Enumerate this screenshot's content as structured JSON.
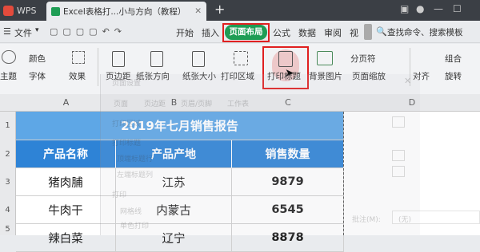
{
  "tabs": {
    "app": "WPS",
    "doc": "Excel表格打...小与方向（教程）",
    "add": "+"
  },
  "menu": {
    "file": "文件",
    "items": [
      "开始",
      "插入",
      "页面布局",
      "公式",
      "数据",
      "审阅",
      "视"
    ],
    "active": "页面布局",
    "search": "查找命令、搜索模板"
  },
  "ribbon": {
    "theme": "主题",
    "color": "颜色",
    "font": "字体",
    "effect": "效果",
    "margin": "页边距",
    "orientation": "纸张方向",
    "size": "纸张大小",
    "print_area": "打印区域",
    "print_title": "打印标题",
    "bg_image": "背景图片",
    "page_break": "分页符",
    "page_zoom": "页面缩放",
    "combine": "组合",
    "align": "对齐",
    "rotate": "旋转"
  },
  "columns": [
    "A",
    "B",
    "C",
    "D"
  ],
  "rows": [
    "1",
    "2",
    "3",
    "4",
    "5"
  ],
  "sheet": {
    "title": "2019年七月销售报告",
    "headers": [
      "产品名称",
      "产品产地",
      "销售数量"
    ],
    "data": [
      [
        "猪肉脯",
        "江苏",
        "9879"
      ],
      [
        "牛肉干",
        "内蒙古",
        "6545"
      ],
      [
        "辣白菜",
        "辽宁",
        "8878"
      ]
    ]
  },
  "dialog": {
    "title": "页面设置",
    "tabs": [
      "页面",
      "页边距",
      "页眉/页脚",
      "工作表"
    ],
    "print_area": "打印区域",
    "print_title": "打印标题",
    "top_row": "顶端标题行",
    "left_col": "左端标题列",
    "print": "打印",
    "gridlines": "网格线",
    "mono": "单色打印",
    "comments": "批注(M):",
    "none": "(无)"
  },
  "colors": {
    "header_blue": "#2e83d6",
    "title_blue": "#5ea7e6",
    "highlight_red": "#e02020",
    "active_green": "#1f9d55"
  }
}
